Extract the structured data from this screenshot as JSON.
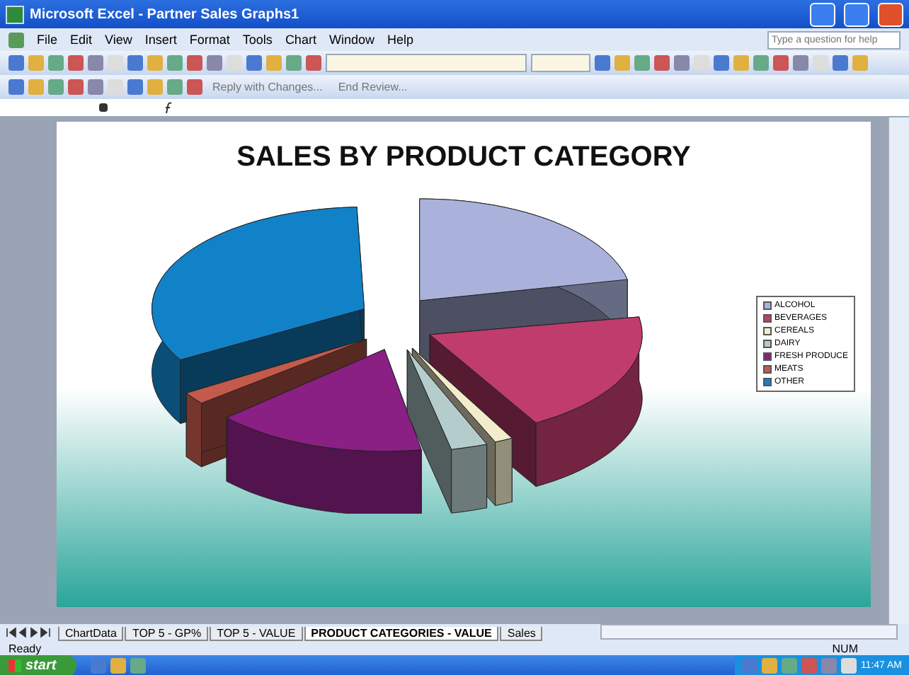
{
  "window": {
    "title": "Microsoft Excel - Partner Sales Graphs1"
  },
  "menu": [
    "File",
    "Edit",
    "View",
    "Insert",
    "Format",
    "Tools",
    "Chart",
    "Window",
    "Help"
  ],
  "help_box": {
    "placeholder": "Type a question for help"
  },
  "review_toolbar": [
    "Reply with Changes...",
    "End Review..."
  ],
  "chart": {
    "title": "SALES BY PRODUCT CATEGORY",
    "legend": [
      {
        "label": "ALCOHOL",
        "color": "#aab2dc"
      },
      {
        "label": "BEVERAGES",
        "color": "#c03c6c"
      },
      {
        "label": "CEREALS",
        "color": "#f2eccc"
      },
      {
        "label": "DAIRY",
        "color": "#b4cccc"
      },
      {
        "label": "FRESH PRODUCE",
        "color": "#8a1f84"
      },
      {
        "label": "MEATS",
        "color": "#c45a4c"
      },
      {
        "label": "OTHER",
        "color": "#1282c8"
      }
    ]
  },
  "sheet_tabs": [
    {
      "label": "ChartData",
      "selected": false
    },
    {
      "label": "TOP 5 - GP%",
      "selected": false
    },
    {
      "label": "TOP 5 - VALUE",
      "selected": false
    },
    {
      "label": "PRODUCT CATEGORIES - VALUE",
      "selected": true
    },
    {
      "label": "Sales",
      "selected": false
    }
  ],
  "status_bar": {
    "left": "Ready",
    "right": "NUM"
  },
  "taskbar": {
    "start": "start",
    "clock": "11:47 AM"
  }
}
